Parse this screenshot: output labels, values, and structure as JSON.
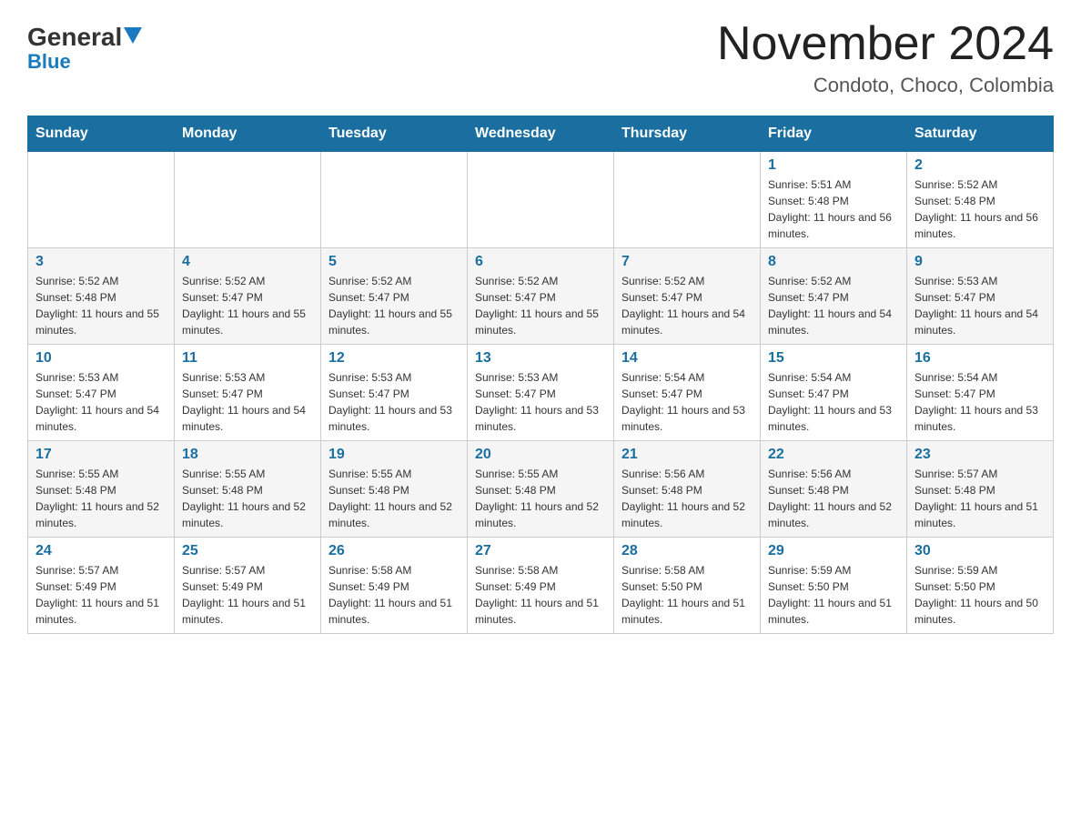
{
  "logo": {
    "general": "General",
    "blue": "Blue",
    "arrow_char": "▼"
  },
  "header": {
    "title": "November 2024",
    "subtitle": "Condoto, Choco, Colombia"
  },
  "weekdays": [
    "Sunday",
    "Monday",
    "Tuesday",
    "Wednesday",
    "Thursday",
    "Friday",
    "Saturday"
  ],
  "weeks": [
    [
      {
        "day": "",
        "info": ""
      },
      {
        "day": "",
        "info": ""
      },
      {
        "day": "",
        "info": ""
      },
      {
        "day": "",
        "info": ""
      },
      {
        "day": "",
        "info": ""
      },
      {
        "day": "1",
        "info": "Sunrise: 5:51 AM\nSunset: 5:48 PM\nDaylight: 11 hours and 56 minutes."
      },
      {
        "day": "2",
        "info": "Sunrise: 5:52 AM\nSunset: 5:48 PM\nDaylight: 11 hours and 56 minutes."
      }
    ],
    [
      {
        "day": "3",
        "info": "Sunrise: 5:52 AM\nSunset: 5:48 PM\nDaylight: 11 hours and 55 minutes."
      },
      {
        "day": "4",
        "info": "Sunrise: 5:52 AM\nSunset: 5:47 PM\nDaylight: 11 hours and 55 minutes."
      },
      {
        "day": "5",
        "info": "Sunrise: 5:52 AM\nSunset: 5:47 PM\nDaylight: 11 hours and 55 minutes."
      },
      {
        "day": "6",
        "info": "Sunrise: 5:52 AM\nSunset: 5:47 PM\nDaylight: 11 hours and 55 minutes."
      },
      {
        "day": "7",
        "info": "Sunrise: 5:52 AM\nSunset: 5:47 PM\nDaylight: 11 hours and 54 minutes."
      },
      {
        "day": "8",
        "info": "Sunrise: 5:52 AM\nSunset: 5:47 PM\nDaylight: 11 hours and 54 minutes."
      },
      {
        "day": "9",
        "info": "Sunrise: 5:53 AM\nSunset: 5:47 PM\nDaylight: 11 hours and 54 minutes."
      }
    ],
    [
      {
        "day": "10",
        "info": "Sunrise: 5:53 AM\nSunset: 5:47 PM\nDaylight: 11 hours and 54 minutes."
      },
      {
        "day": "11",
        "info": "Sunrise: 5:53 AM\nSunset: 5:47 PM\nDaylight: 11 hours and 54 minutes."
      },
      {
        "day": "12",
        "info": "Sunrise: 5:53 AM\nSunset: 5:47 PM\nDaylight: 11 hours and 53 minutes."
      },
      {
        "day": "13",
        "info": "Sunrise: 5:53 AM\nSunset: 5:47 PM\nDaylight: 11 hours and 53 minutes."
      },
      {
        "day": "14",
        "info": "Sunrise: 5:54 AM\nSunset: 5:47 PM\nDaylight: 11 hours and 53 minutes."
      },
      {
        "day": "15",
        "info": "Sunrise: 5:54 AM\nSunset: 5:47 PM\nDaylight: 11 hours and 53 minutes."
      },
      {
        "day": "16",
        "info": "Sunrise: 5:54 AM\nSunset: 5:47 PM\nDaylight: 11 hours and 53 minutes."
      }
    ],
    [
      {
        "day": "17",
        "info": "Sunrise: 5:55 AM\nSunset: 5:48 PM\nDaylight: 11 hours and 52 minutes."
      },
      {
        "day": "18",
        "info": "Sunrise: 5:55 AM\nSunset: 5:48 PM\nDaylight: 11 hours and 52 minutes."
      },
      {
        "day": "19",
        "info": "Sunrise: 5:55 AM\nSunset: 5:48 PM\nDaylight: 11 hours and 52 minutes."
      },
      {
        "day": "20",
        "info": "Sunrise: 5:55 AM\nSunset: 5:48 PM\nDaylight: 11 hours and 52 minutes."
      },
      {
        "day": "21",
        "info": "Sunrise: 5:56 AM\nSunset: 5:48 PM\nDaylight: 11 hours and 52 minutes."
      },
      {
        "day": "22",
        "info": "Sunrise: 5:56 AM\nSunset: 5:48 PM\nDaylight: 11 hours and 52 minutes."
      },
      {
        "day": "23",
        "info": "Sunrise: 5:57 AM\nSunset: 5:48 PM\nDaylight: 11 hours and 51 minutes."
      }
    ],
    [
      {
        "day": "24",
        "info": "Sunrise: 5:57 AM\nSunset: 5:49 PM\nDaylight: 11 hours and 51 minutes."
      },
      {
        "day": "25",
        "info": "Sunrise: 5:57 AM\nSunset: 5:49 PM\nDaylight: 11 hours and 51 minutes."
      },
      {
        "day": "26",
        "info": "Sunrise: 5:58 AM\nSunset: 5:49 PM\nDaylight: 11 hours and 51 minutes."
      },
      {
        "day": "27",
        "info": "Sunrise: 5:58 AM\nSunset: 5:49 PM\nDaylight: 11 hours and 51 minutes."
      },
      {
        "day": "28",
        "info": "Sunrise: 5:58 AM\nSunset: 5:50 PM\nDaylight: 11 hours and 51 minutes."
      },
      {
        "day": "29",
        "info": "Sunrise: 5:59 AM\nSunset: 5:50 PM\nDaylight: 11 hours and 51 minutes."
      },
      {
        "day": "30",
        "info": "Sunrise: 5:59 AM\nSunset: 5:50 PM\nDaylight: 11 hours and 50 minutes."
      }
    ]
  ]
}
